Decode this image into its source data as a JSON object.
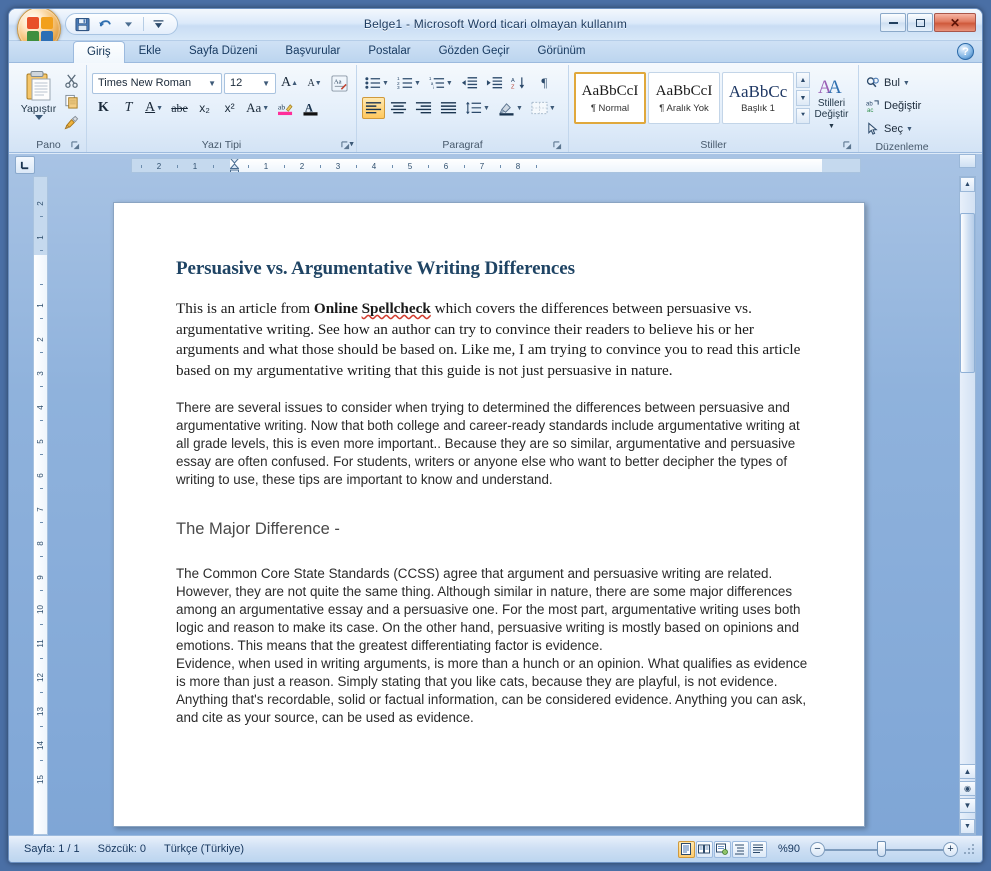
{
  "window": {
    "title": "Belge1 - Microsoft Word ticari olmayan kullanım",
    "minimize_label": "Simge Durumuna Küçült",
    "restore_label": "Önceki Boyut",
    "close_label": "Kapat",
    "help_label": "?"
  },
  "quick_access": {
    "save": "Kaydet",
    "undo": "Geri Al",
    "customize": "Araç Çubuğunu Özelleştir"
  },
  "tabs": [
    {
      "label": "Giriş",
      "active": true
    },
    {
      "label": "Ekle",
      "active": false
    },
    {
      "label": "Sayfa Düzeni",
      "active": false
    },
    {
      "label": "Başvurular",
      "active": false
    },
    {
      "label": "Postalar",
      "active": false
    },
    {
      "label": "Gözden Geçir",
      "active": false
    },
    {
      "label": "Görünüm",
      "active": false
    }
  ],
  "ribbon": {
    "clipboard": {
      "group_label": "Pano",
      "paste_label": "Yapıştır",
      "cut_label": "Kes",
      "copy_label": "Kopyala",
      "format_painter_label": "Biçim Boyacısı"
    },
    "font": {
      "group_label": "Yazı Tipi",
      "font_name": "Times New Roman",
      "font_size": "12",
      "grow_font": "A",
      "shrink_font": "A",
      "clear_formatting": "Aa",
      "bold": "K",
      "italic": "T",
      "underline": "A",
      "strikethrough": "abe",
      "subscript": "x₂",
      "superscript": "x²",
      "change_case": "Aa",
      "highlight": "ab",
      "font_color": "A"
    },
    "paragraph": {
      "group_label": "Paragraf",
      "bullets": "Madde İşaretleri",
      "numbering": "Numaralandırma",
      "multilevel": "Çok Düzeyli Liste",
      "decrease_indent": "Girintiyi Azalt",
      "increase_indent": "Girintiyi Artır",
      "sort": "Sırala",
      "show_marks": "¶",
      "align_left": "Metni Sola Hizala",
      "align_center": "Ortala",
      "align_right": "Metni Sağa Hizala",
      "justify": "Yasla",
      "line_spacing": "Satır Aralığı",
      "shading": "Gölgelendirme",
      "borders": "Kenarlıklar"
    },
    "styles": {
      "group_label": "Stiller",
      "items": [
        {
          "sample": "AaBbCcI",
          "name": "¶ Normal",
          "active": true
        },
        {
          "sample": "AaBbCcI",
          "name": "¶ Aralık Yok",
          "active": false
        },
        {
          "sample": "AaBbCc",
          "name": "Başlık 1",
          "active": false
        }
      ],
      "change_styles_line1": "Stilleri",
      "change_styles_line2": "Değiştir"
    },
    "editing": {
      "group_label": "Düzenleme",
      "find": "Bul",
      "replace": "Değiştir",
      "select": "Seç"
    }
  },
  "rulers": {
    "tab_stop_selector": "Sol Sekme",
    "horizontal_ticks": [
      "2",
      "1",
      "1",
      "2",
      "3",
      "4",
      "5",
      "6",
      "7",
      "8"
    ],
    "vertical_ticks": [
      "2",
      "1",
      "1",
      "2",
      "3",
      "4",
      "5",
      "6",
      "7",
      "8",
      "9",
      "10",
      "11",
      "12",
      "13",
      "14",
      "15"
    ]
  },
  "document": {
    "heading": "Persuasive vs. Argumentative Writing Differences",
    "para1": {
      "pre": "This is an article from ",
      "bold_ok": "Online ",
      "misspelled": "Spellcheck",
      "post": " which covers the differences between persuasive vs. argumentative writing. See how an author can try to convince their readers to believe his or her arguments and what those should be based on. Like me, I am trying to convince you to read this article based on my argumentative writing that this guide is not just persuasive in nature."
    },
    "para2": "There are several issues to consider when trying to determined the differences between persuasive and argumentative writing. Now that both college and career-ready standards include argumentative writing at all grade levels, this is even more important.. Because they are so similar, argumentative and persuasive essay are often confused. For students, writers or anyone else who want to better decipher the types of writing to use, these tips are important to know and understand.",
    "subheading": "The Major Difference -",
    "para3": "The Common Core State Standards (CCSS) agree that argument and persuasive writing are related. However, they are not quite the same thing. Although similar in nature, there are some major differences among an argumentative essay and a persuasive one. For the most part, argumentative writing uses both logic and reason to make its case. On the other hand, persuasive writing is mostly based on opinions and emotions. This means that the greatest differentiating factor is evidence.",
    "para4": "Evidence, when used in writing arguments, is more than a hunch or an opinion. What qualifies as evidence is more than just a reason. Simply stating that you like cats, because they are playful, is not evidence. Anything that's recordable, solid or factual information, can be considered evidence. Anything you can ask, and cite as your source, can be used as evidence."
  },
  "statusbar": {
    "page": "Sayfa: 1 / 1",
    "words": "Sözcük: 0",
    "language": "Türkçe (Türkiye)",
    "views": [
      {
        "name": "print-layout",
        "active": true
      },
      {
        "name": "full-screen-reading",
        "active": false
      },
      {
        "name": "web-layout",
        "active": false
      },
      {
        "name": "outline",
        "active": false
      },
      {
        "name": "draft",
        "active": false
      }
    ],
    "zoom": "%90",
    "zoom_out": "−",
    "zoom_in": "+"
  },
  "colors": {
    "heading": "#1f4464",
    "accent_orange": "#f2a01c",
    "spell_error": "#d23b2e",
    "chrome_blue": "#bcd5ef"
  }
}
